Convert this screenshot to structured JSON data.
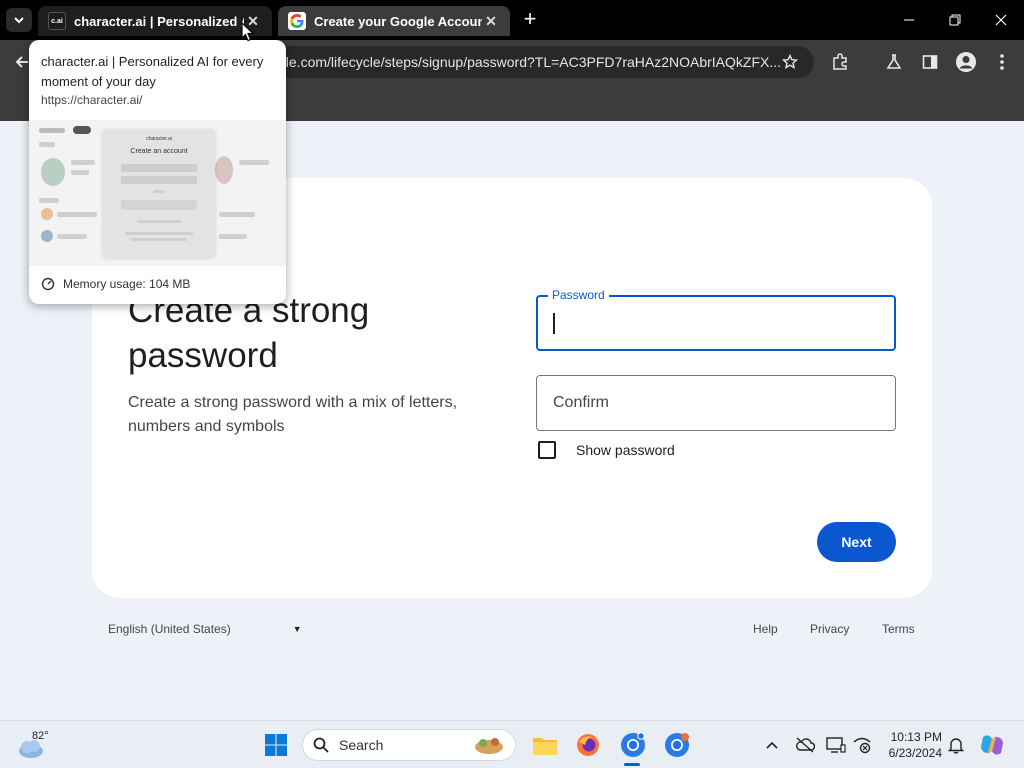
{
  "browser": {
    "tabs": [
      {
        "title": "character.ai | Personalized AI for every moment of your day",
        "favicon": "c.ai"
      },
      {
        "title": "Create your Google Account"
      }
    ],
    "address_bar": "gle.com/lifecycle/steps/signup/password?TL=AC3PFD7raHAz2NOAbrIAQkZFX..."
  },
  "hover_card": {
    "title": "character.ai | Personalized AI for every moment of your day",
    "url": "https://character.ai/",
    "memory": "Memory usage: 104 MB",
    "thumb_brand": "character.ai",
    "thumb_heading": "Create an account"
  },
  "page": {
    "heading": "Create a strong password",
    "subtext": "Create a strong password with a mix of letters, numbers and symbols",
    "password_label": "Password",
    "confirm_placeholder": "Confirm",
    "show_password": "Show password",
    "next_button": "Next"
  },
  "footer": {
    "language": "English (United States)",
    "help": "Help",
    "privacy": "Privacy",
    "terms": "Terms"
  },
  "taskbar": {
    "temperature": "82°",
    "search_label": "Search",
    "time": "10:13 PM",
    "date": "6/23/2024"
  },
  "colors": {
    "accent": "#0b57d0",
    "page_bg": "#eef2f8",
    "card_bg": "#ffffff"
  }
}
